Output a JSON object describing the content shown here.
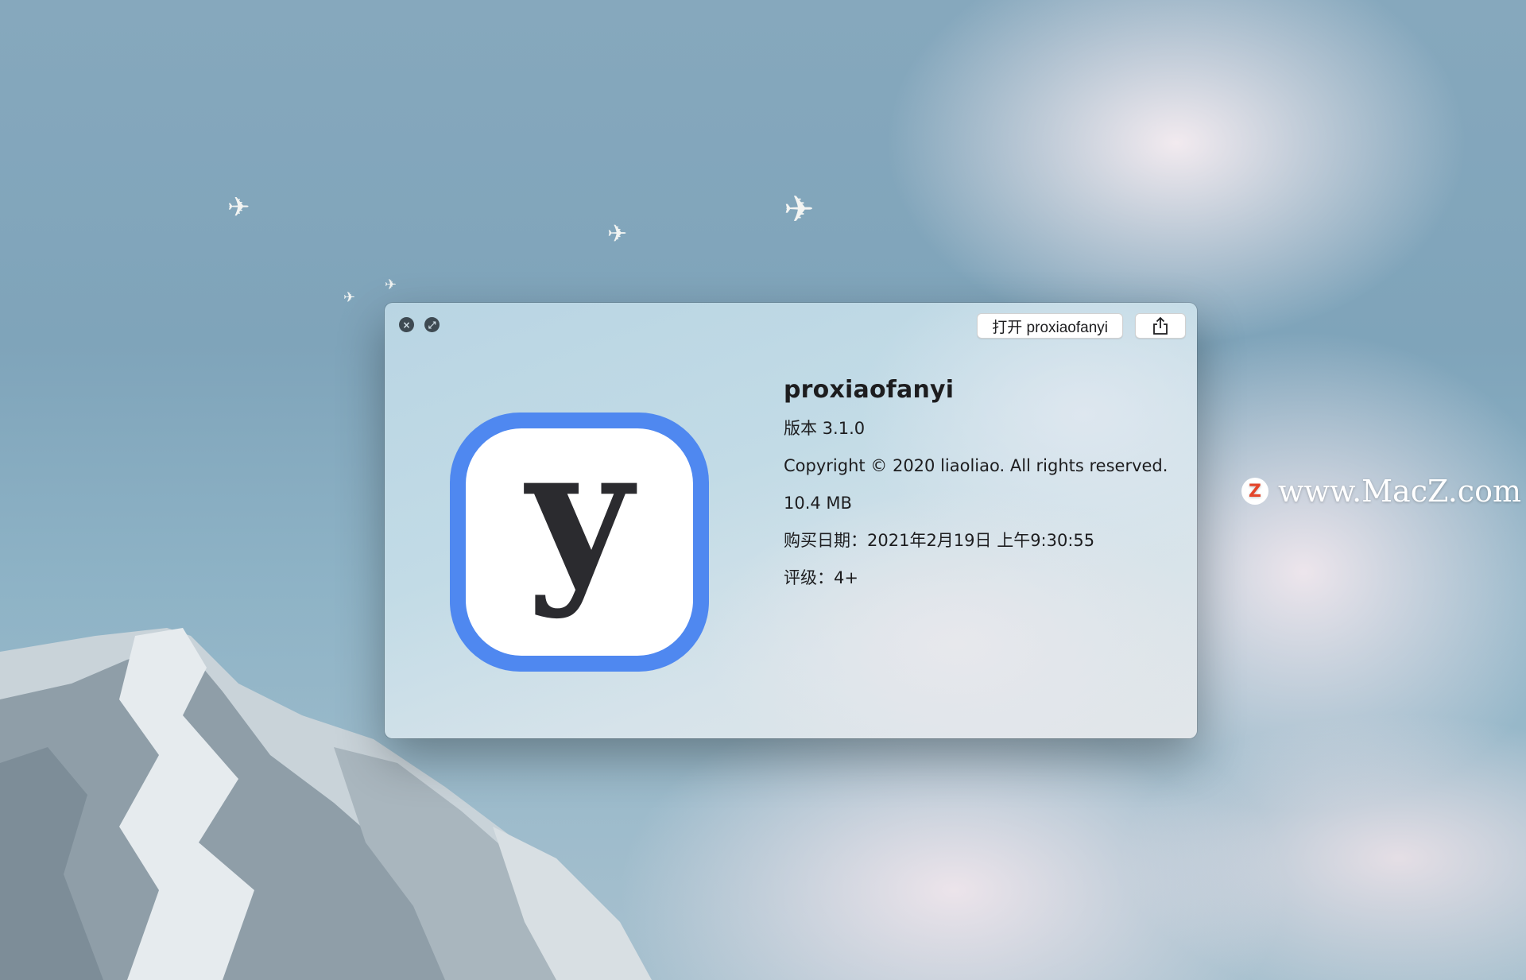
{
  "window": {
    "traffic_close": "×",
    "traffic_fullscreen": "⤢",
    "open_button_label": "打开 proxiaofanyi",
    "share_icon": "share-icon"
  },
  "app": {
    "icon_glyph": "y",
    "icon_color": "#4f88f0",
    "name": "proxiaofanyi",
    "version": "版本 3.1.0",
    "copyright": "Copyright © 2020 liaoliao. All rights reserved.",
    "size": "10.4 MB",
    "purchase_date": "购买日期：2021年2月19日 上午9:30:55",
    "rating": "评级：4+"
  },
  "watermark": {
    "logo": "Z",
    "text": "www.MacZ.com"
  }
}
